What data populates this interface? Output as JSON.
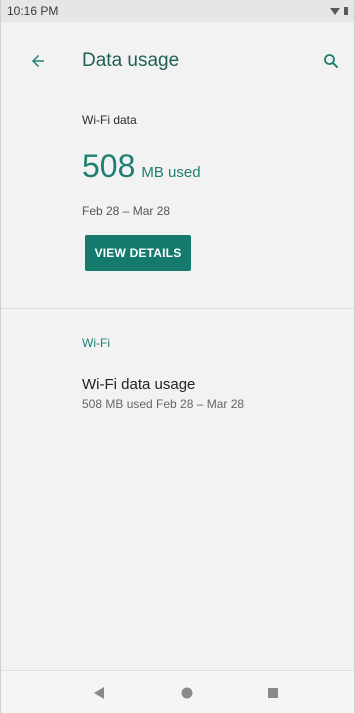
{
  "status_bar": {
    "time": "10:16 PM"
  },
  "toolbar": {
    "title": "Data usage",
    "back_icon": "arrow-back-icon",
    "search_icon": "search-icon"
  },
  "summary": {
    "label": "Wi-Fi data",
    "amount": "508",
    "unit": "MB used",
    "date_range": "Feb 28 – Mar 28",
    "button_label": "VIEW DETAILS"
  },
  "wifi": {
    "header": "Wi-Fi",
    "item_title": "Wi-Fi data usage",
    "item_subtitle": "508 MB used Feb 28 – Mar 28"
  },
  "nav_bar": {
    "back_icon": "nav-back-icon",
    "home_icon": "nav-home-icon",
    "recents_icon": "nav-recents-icon"
  },
  "colors": {
    "accent": "#1f7f72",
    "button": "#137a6c",
    "title": "#1f5f57"
  }
}
